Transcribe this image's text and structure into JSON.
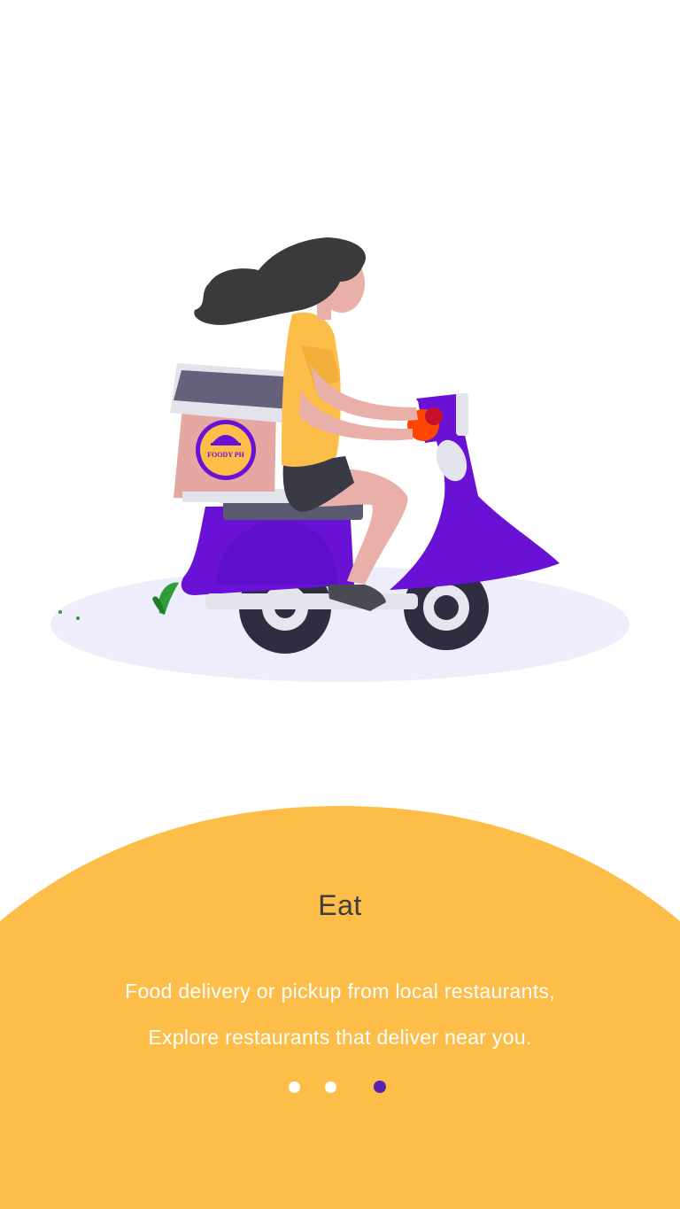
{
  "onboarding": {
    "title": "Eat",
    "description_line1": "Food delivery or pickup from local restaurants,",
    "description_line2": "Explore restaurants that deliver near you.",
    "current_page": 3,
    "total_pages": 3
  },
  "illustration": {
    "subject": "delivery-scooter-rider",
    "box_logo_text": "FOODY PH"
  },
  "colors": {
    "background": "#ffffff",
    "panel": "#FDBD49",
    "scooter": "#6A11D6",
    "accent": "#5A22B0",
    "dot_inactive": "#ffffff",
    "dot_active": "#5A22B0"
  }
}
